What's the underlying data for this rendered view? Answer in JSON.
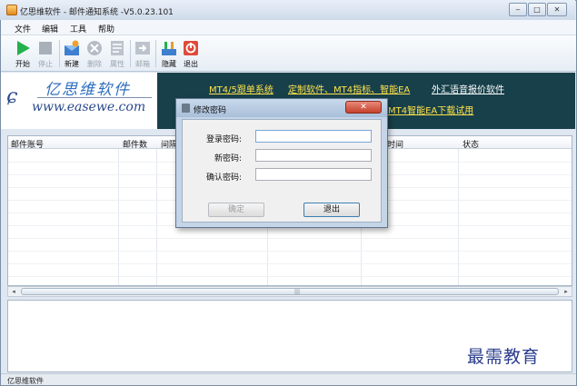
{
  "window": {
    "title": "亿思维软件 - 邮件通知系统 -V5.0.23.101",
    "controls": {
      "minimize": "‒",
      "maximize": "□",
      "close": "✕"
    }
  },
  "menu": [
    "文件",
    "编辑",
    "工具",
    "帮助"
  ],
  "toolbar": [
    {
      "label": "开始",
      "icon": "play-icon",
      "enabled": true
    },
    {
      "label": "停止",
      "icon": "stop-icon",
      "enabled": false
    },
    {
      "label": "新建",
      "icon": "new-mail-icon",
      "enabled": true
    },
    {
      "label": "删除",
      "icon": "delete-icon",
      "enabled": false
    },
    {
      "label": "属性",
      "icon": "properties-icon",
      "enabled": false
    },
    {
      "label": "邮箱",
      "icon": "mailbox-icon",
      "enabled": false
    },
    {
      "label": "隐藏",
      "icon": "hide-icon",
      "enabled": true
    },
    {
      "label": "退出",
      "icon": "exit-icon",
      "enabled": true
    }
  ],
  "banner": {
    "logo_cn": "亿思维软件",
    "logo_url": "www.easewe.com",
    "links": [
      "MT4/5跟单系统",
      "定制软件、MT4指标、智能EA",
      "外汇语音报价软件",
      "MT4智能EA下载试用"
    ]
  },
  "grid": {
    "columns": [
      "邮件账号",
      "邮件数",
      "间隔",
      "时间",
      "状态"
    ]
  },
  "status_text": "亿思维软件",
  "watermark": "最需教育",
  "dialog": {
    "title": "修改密码",
    "close": "✕",
    "fields": [
      {
        "label": "登录密码:",
        "value": ""
      },
      {
        "label": "新密码:",
        "value": ""
      },
      {
        "label": "确认密码:",
        "value": ""
      }
    ],
    "ok": "确定",
    "exit": "退出"
  },
  "colors": {
    "banner_bg": "#18404a",
    "link_yellow": "#ffe24a",
    "play_green": "#22b14c",
    "dialog_frame": "#c5d5e8"
  }
}
